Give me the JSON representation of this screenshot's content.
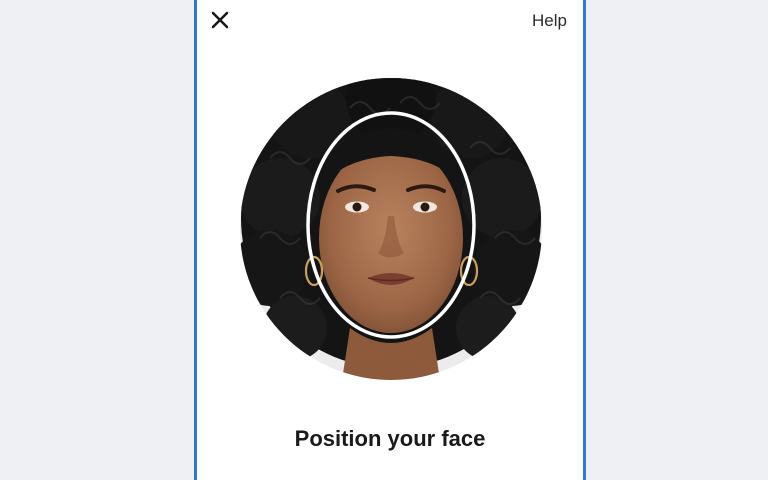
{
  "topbar": {
    "close_icon": "close-icon",
    "help_label": "Help"
  },
  "camera": {
    "guide_shape": "oval",
    "guide_color": "#ffffff"
  },
  "prompt": {
    "title": "Position your face"
  },
  "colors": {
    "frame_border": "#2f79d6",
    "background": "#eef0f4",
    "surface": "#ffffff",
    "text": "#1a1a1a"
  }
}
